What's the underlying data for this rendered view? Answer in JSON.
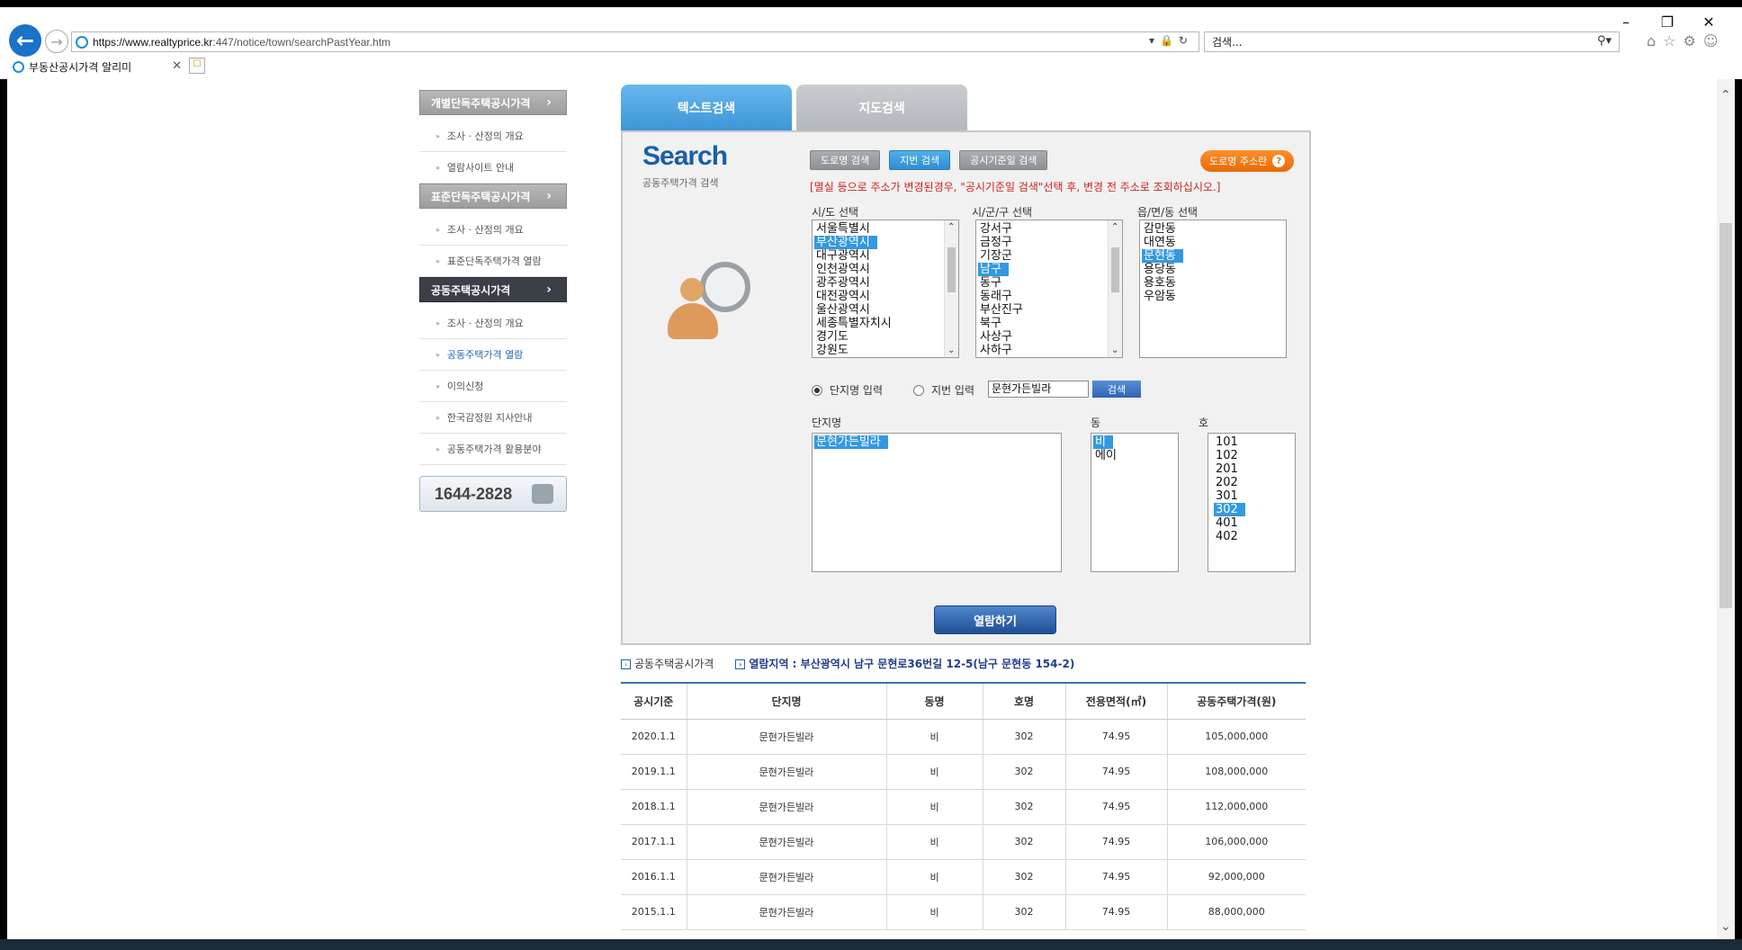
{
  "browser": {
    "url_host": "https://www.realtyprice.kr",
    "url_path": ":447/notice/town/searchPastYear.htm",
    "search_placeholder": "검색...",
    "tab_title": "부동산공시가격 알리미"
  },
  "sidebar": {
    "sections": [
      {
        "label": "개별단독주택공시가격",
        "items": [
          "조사 · 산정의 개요",
          "열람사이트 안내"
        ]
      },
      {
        "label": "표준단독주택공시가격",
        "items": [
          "조사 · 산정의 개요",
          "표준단독주택가격 열람"
        ]
      },
      {
        "label": "공동주택공시가격",
        "items": [
          "조사 · 산정의 개요",
          "공동주택가격 열람",
          "이의신청",
          "한국감정원 지사안내",
          "공동주택가격 활용분야"
        ]
      }
    ],
    "phone": "1644-2828"
  },
  "search_tabs": {
    "text": "텍스트검색",
    "map": "지도검색"
  },
  "panel": {
    "logo": "Search",
    "logo_sub": "공동주택가격 검색",
    "btn_road": "도로명 검색",
    "btn_lot": "지번 검색",
    "btn_base": "공시기준일 검색",
    "btn_road_addr": "도로명 주소란",
    "notice": "[멸실 등으로 주소가 변경된경우, \"공시기준일 검색\"선택 후, 변경 전 주소로 조회하십시오.]",
    "sido_label": "시/도 선택",
    "sigungu_label": "시/군/구 선택",
    "dong_select_label": "읍/면/동 선택",
    "sido": [
      "서울특별시",
      "부산광역시",
      "대구광역시",
      "인천광역시",
      "광주광역시",
      "대전광역시",
      "울산광역시",
      "세종특별자치시",
      "경기도",
      "강원도"
    ],
    "sido_selected": 1,
    "sigungu": [
      "강서구",
      "금정구",
      "기장군",
      "남구",
      "동구",
      "동래구",
      "부산진구",
      "북구",
      "사상구",
      "사하구"
    ],
    "sigungu_selected": 3,
    "emd": [
      "감만동",
      "대연동",
      "문현동",
      "용당동",
      "용호동",
      "우암동"
    ],
    "emd_selected": 2,
    "radio_name": "단지명 입력",
    "radio_lot": "지번 입력",
    "input_value": "문현가든빌라",
    "search_btn": "검색",
    "complex_label": "단지명",
    "dong_label": "동",
    "ho_label": "호",
    "complexes": [
      "문현가든빌라"
    ],
    "dongs": [
      "비",
      "에이"
    ],
    "hos": [
      "101",
      "102",
      "201",
      "202",
      "301",
      "302",
      "401",
      "402"
    ],
    "view_btn": "열람하기"
  },
  "results": {
    "title": "공동주택공시가격",
    "region_label": "열람지역 :",
    "region_value": "부산광역시 남구 문현로36번길 12-5(남구 문현동 154-2)",
    "columns": [
      "공시기준",
      "단지명",
      "동명",
      "호명",
      "전용면적(㎡)",
      "공동주택가격(원)"
    ],
    "rows": [
      [
        "2020.1.1",
        "문현가든빌라",
        "비",
        "302",
        "74.95",
        "105,000,000"
      ],
      [
        "2019.1.1",
        "문현가든빌라",
        "비",
        "302",
        "74.95",
        "108,000,000"
      ],
      [
        "2018.1.1",
        "문현가든빌라",
        "비",
        "302",
        "74.95",
        "112,000,000"
      ],
      [
        "2017.1.1",
        "문현가든빌라",
        "비",
        "302",
        "74.95",
        "106,000,000"
      ],
      [
        "2016.1.1",
        "문현가든빌라",
        "비",
        "302",
        "74.95",
        "92,000,000"
      ],
      [
        "2015.1.1",
        "문현가든빌라",
        "비",
        "302",
        "74.95",
        "88,000,000"
      ]
    ]
  }
}
